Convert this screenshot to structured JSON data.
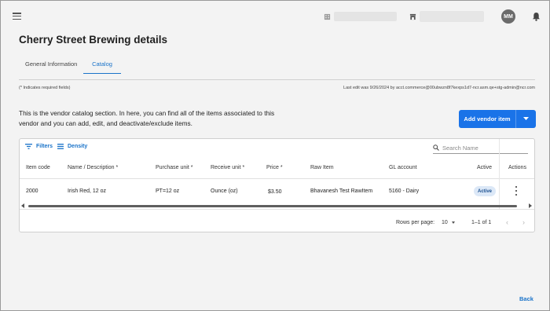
{
  "header": {
    "avatar_initials": "MM"
  },
  "page": {
    "title": "Cherry Street Brewing details",
    "tabs": [
      {
        "label": "General Information",
        "active": false
      },
      {
        "label": "Catalog",
        "active": true
      }
    ],
    "required_note": "(* Indicates required fields)",
    "last_edit": "Last edit was 9/26/2024 by acct.commerce@00ubwzn8f7kexps1d7-ncr.asm.qe+stg-admin@ncr.com",
    "description": "This is the vendor catalog section. In here, you can find all of the items associated to this vendor and you can add, edit, and deactivate/exclude items.",
    "add_button_label": "Add vendor item",
    "back_label": "Back"
  },
  "table": {
    "toolbar": {
      "filters_label": "Filters",
      "density_label": "Density",
      "search_placeholder": "Search Name"
    },
    "columns": [
      "Item code",
      "Name / Description *",
      "Purchase unit *",
      "Receive unit *",
      "Price *",
      "Raw Item",
      "GL account",
      "Active",
      "Actions"
    ],
    "rows": [
      {
        "item_code": "2000",
        "name": "Irish Red, 12 oz",
        "purchase_unit": "PT=12 oz",
        "receive_unit": "Ounce (oz)",
        "price": "$3.50",
        "raw_item": "Bhavanesh Test RawItem",
        "gl_account": "5160 - Dairy",
        "active": "Active"
      }
    ],
    "footer": {
      "rows_per_page_label": "Rows per page:",
      "rows_per_page_value": "10",
      "page_range": "1–1 of 1"
    }
  },
  "colors": {
    "accent": "#1a73e8",
    "link": "#1a73c9",
    "badge_bg": "#dce8f7"
  },
  "icons": {
    "menu": "hamburger-icon",
    "org": "building-icon",
    "store": "store-icon",
    "notifications": "bell-icon",
    "filters": "filter-icon",
    "density": "density-icon",
    "search": "search-icon",
    "row_actions": "more-vert-icon",
    "add_dropdown": "chevron-down-icon"
  }
}
